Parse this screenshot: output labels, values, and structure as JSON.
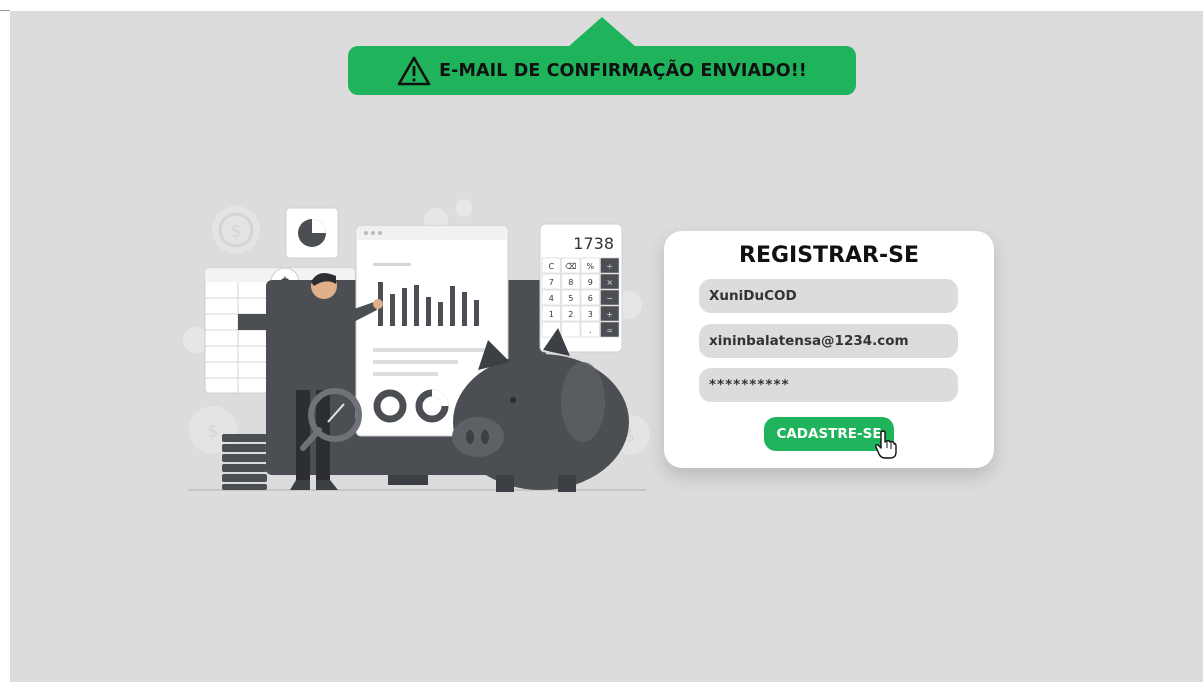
{
  "toast": {
    "message": "E-MAIL DE CONFIRMAÇÃO ENVIADO!!",
    "icon": "warning-icon",
    "color": "#1fb45c"
  },
  "illustration": {
    "calculator_display": "1738",
    "calculator_keys": [
      "C",
      "⌫",
      "%",
      "÷",
      "7",
      "8",
      "9",
      "×",
      "4",
      "5",
      "6",
      "−",
      "1",
      "2",
      "3",
      "+",
      "",
      "",
      ".",
      "="
    ],
    "coin_symbol": "$"
  },
  "register": {
    "title": "REGISTRAR-SE",
    "username_value": "XuniDuCOD",
    "email_value": "xininbalatensa@1234.com",
    "password_value": "**********",
    "submit_label": "CADASTRE-SE",
    "accent_color": "#1fb45c"
  }
}
